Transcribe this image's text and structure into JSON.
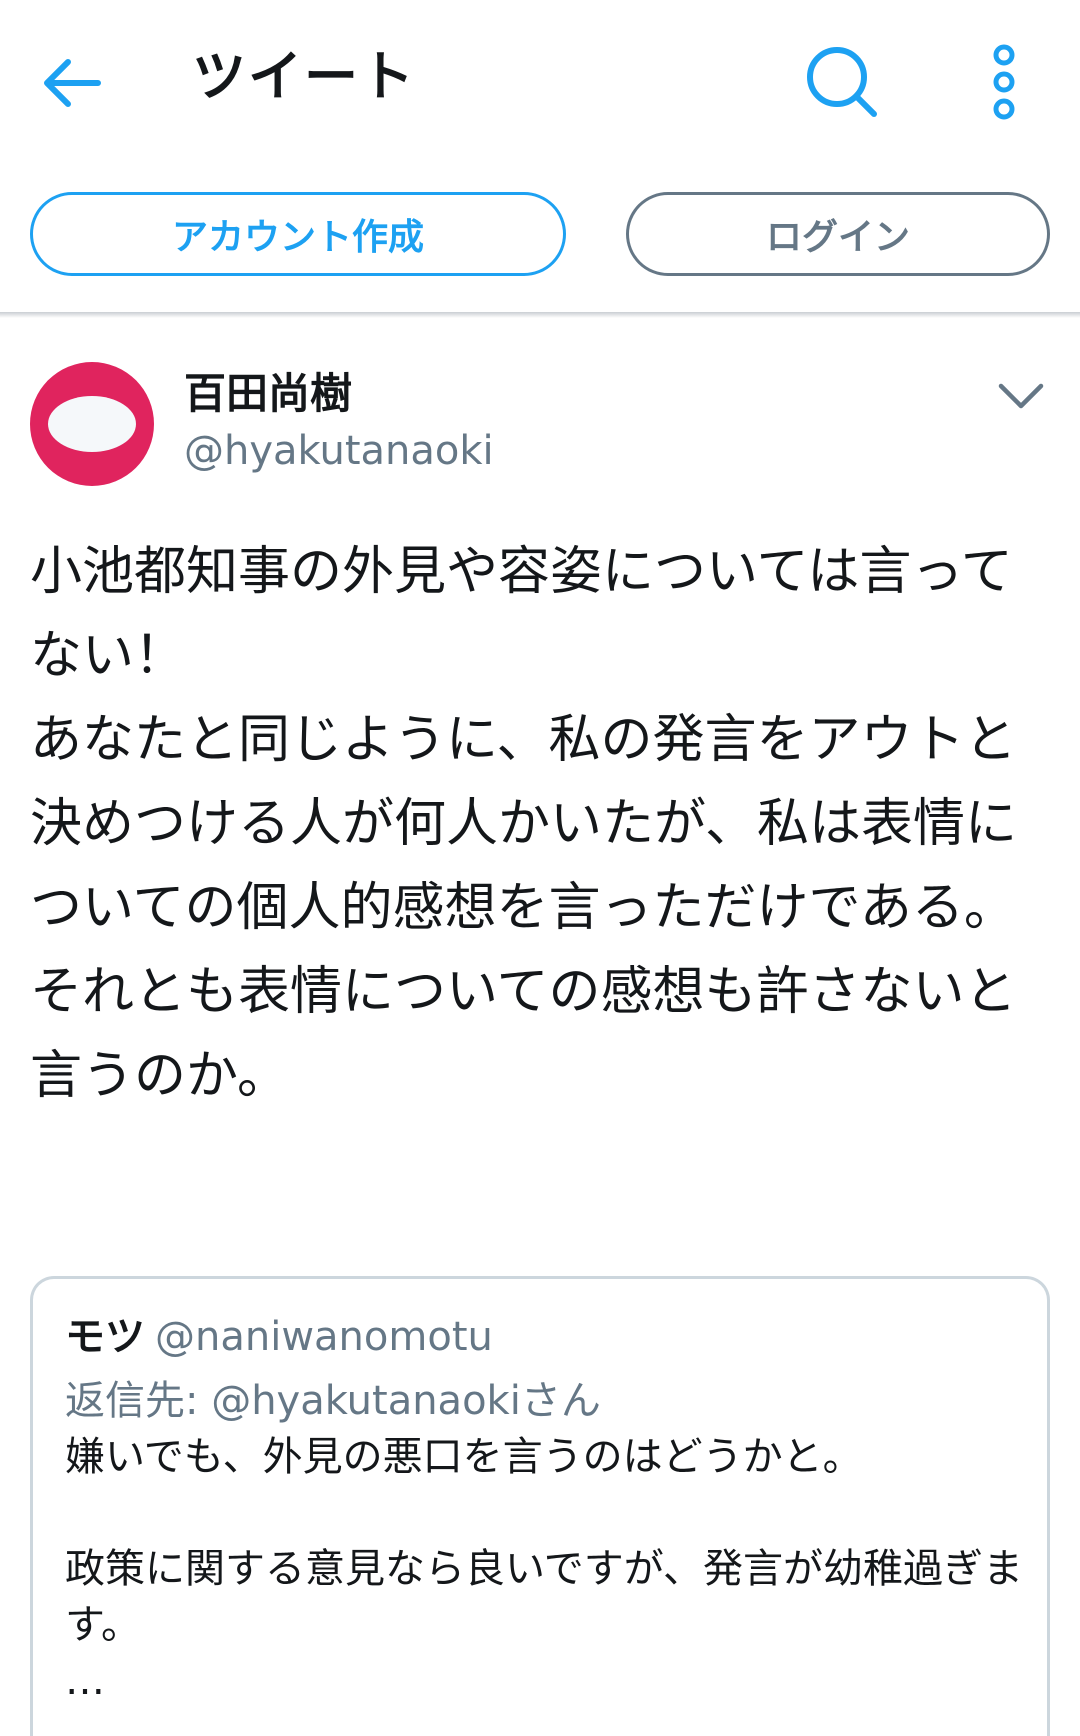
{
  "header": {
    "title": "ツイート",
    "back_icon": "arrow-left-icon",
    "search_icon": "search-icon",
    "more_icon": "more-vertical-icon"
  },
  "auth": {
    "signup_label": "アカウント作成",
    "login_label": "ログイン"
  },
  "tweet": {
    "author_name": "百田尚樹",
    "author_handle": "@hyakutanaoki",
    "caret_icon": "chevron-down-icon",
    "text": "小池都知事の外見や容姿については言ってない！\nあなたと同じように、私の発言をアウトと決めつける人が何人かいたが、私は表情についての個人的感想を言っただけである。\nそれとも表情についての感想も許さないと言うのか。"
  },
  "quote": {
    "name": "モツ",
    "handle": "@naniwanomotu",
    "reply_to": "返信先: @hyakutanaokiさん",
    "text": "嫌いでも、外見の悪口を言うのはどうかと。\n\n政策に関する意見なら良いですが、発言が幼稚過ぎます。\n…"
  },
  "colors": {
    "accent": "#1da1f2",
    "secondary": "#657786",
    "avatar": "#e0245e",
    "border": "#ccd6dd"
  }
}
